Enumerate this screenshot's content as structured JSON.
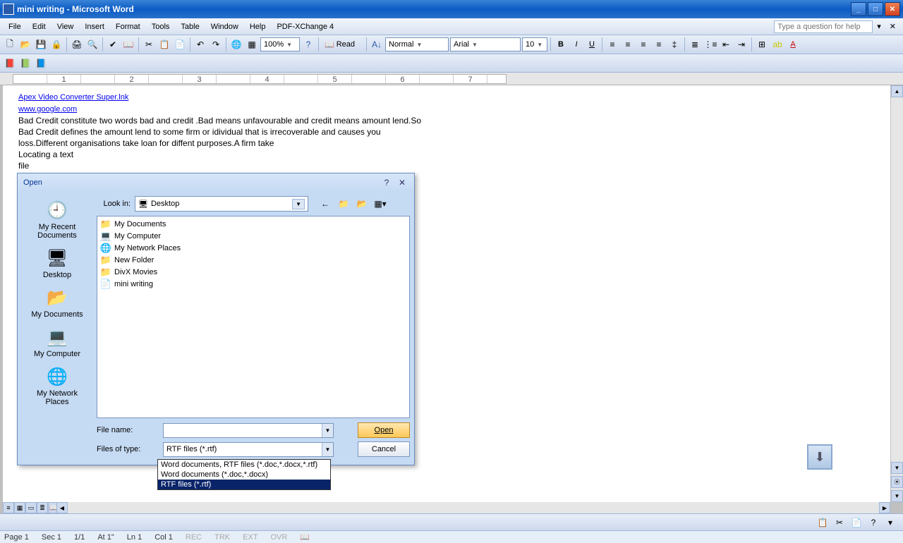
{
  "window": {
    "title": "mini writing - Microsoft Word"
  },
  "menu": {
    "items": [
      "File",
      "Edit",
      "View",
      "Insert",
      "Format",
      "Tools",
      "Table",
      "Window",
      "Help",
      "PDF-XChange 4"
    ],
    "help_placeholder": "Type a question for help"
  },
  "toolbar1": {
    "zoom": "100%",
    "read_label": "Read"
  },
  "formatting": {
    "style": "Normal",
    "font": "Arial",
    "size": "10"
  },
  "ruler": {
    "ticks": [
      "",
      "1",
      "",
      "2",
      "",
      "3",
      "",
      "4",
      "",
      "5",
      "",
      "6",
      "",
      "7"
    ]
  },
  "document": {
    "link1": "Apex Video Converter Super.lnk",
    "link2": "www.google.com",
    "para1": "Bad Credit constitute two words bad and credit .Bad means unfavourable and credit means amount lend.So Bad Credit defines the amount lend to some firm or idividual that is irrecoverable and causes you loss.Different organisations take loan for diffent purposes.A firm take",
    "para2": "Locating a text",
    "para3": "file"
  },
  "dialog": {
    "title": "Open",
    "lookin_label": "Look in:",
    "lookin_value": "Desktop",
    "places": [
      {
        "icon": "🕘",
        "label": "My Recent Documents"
      },
      {
        "icon": "🖥",
        "label": "Desktop"
      },
      {
        "icon": "📂",
        "label": "My Documents"
      },
      {
        "icon": "💻",
        "label": "My Computer"
      },
      {
        "icon": "🌐",
        "label": "My Network Places"
      }
    ],
    "files": [
      {
        "icon": "📁",
        "name": "My Documents"
      },
      {
        "icon": "💻",
        "name": "My Computer"
      },
      {
        "icon": "🌐",
        "name": "My Network Places"
      },
      {
        "icon": "📁",
        "name": "New Folder"
      },
      {
        "icon": "📁",
        "name": "DivX Movies"
      },
      {
        "icon": "📄",
        "name": "mini writing"
      }
    ],
    "filename_label": "File name:",
    "filename_value": "",
    "filetype_label": "Files of type:",
    "filetype_value": "RTF files (*.rtf)",
    "open_btn": "Open",
    "cancel_btn": "Cancel",
    "type_options": [
      "Word documents, RTF files (*.doc,*.docx,*.rtf)",
      "Word documents (*.doc,*.docx)",
      "RTF files (*.rtf)"
    ]
  },
  "status": {
    "page": "Page  1",
    "sec": "Sec  1",
    "pp": "1/1",
    "at": "At  1\"",
    "ln": "Ln  1",
    "col": "Col  1",
    "rec": "REC",
    "trk": "TRK",
    "ext": "EXT",
    "ovr": "OVR"
  }
}
